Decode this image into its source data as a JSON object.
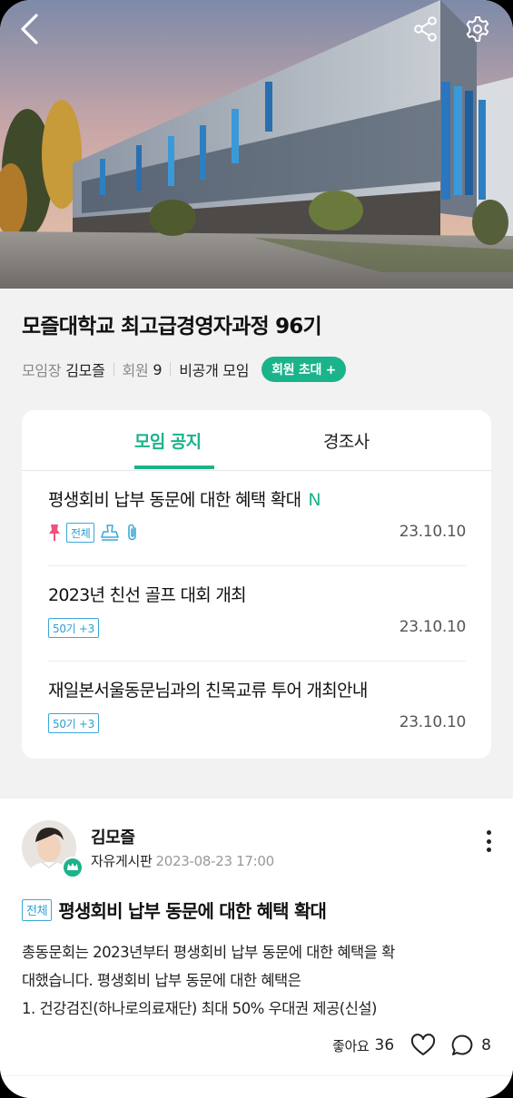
{
  "header": {
    "back_icon": "chevron-left-icon",
    "share_icon": "share-icon",
    "settings_icon": "gear-icon"
  },
  "group": {
    "title": "모즐대학교 최고급경영자과정 96기",
    "leader_label": "모임장",
    "leader_name": "김모즐",
    "member_label": "회원",
    "member_count": "9",
    "privacy": "비공개 모임",
    "invite_button": "회원 초대 +"
  },
  "tabs": [
    {
      "label": "모임 공지",
      "active": true
    },
    {
      "label": "경조사",
      "active": false
    }
  ],
  "notices": [
    {
      "title": "평생회비 납부 동문에 대한 혜택 확대",
      "new_badge": "N",
      "tag": "전체",
      "date": "23.10.10",
      "icons": [
        "pin-icon",
        "stamp-icon",
        "attachment-icon"
      ]
    },
    {
      "title": "2023년 친선 골프 대회 개최",
      "tag": "50기 +3",
      "date": "23.10.10"
    },
    {
      "title": "재일본서울동문님과의 친목교류 투어 개최안내",
      "tag": "50기 +3",
      "date": "23.10.10"
    }
  ],
  "post": {
    "author": "김모즐",
    "board": "자유게시판",
    "timestamp": "2023-08-23 17:00",
    "tag": "전체",
    "title": "평생회비 납부 동문에 대한 혜택 확대",
    "body_lines": [
      "총동문회는 2023년부터 평생회비 납부 동문에 대한 혜택을 확",
      "대했습니다. 평생회비 납부 동문에 대한 혜택은",
      "1. 건강검진(하나로의료재단) 최대 50% 우대권 제공(신설)"
    ],
    "like_label": "좋아요",
    "like_count": "36",
    "comment_count": "8"
  },
  "colors": {
    "accent": "#1bb38a",
    "tag_blue": "#2e9fd0",
    "pin_pink": "#f0517a"
  }
}
